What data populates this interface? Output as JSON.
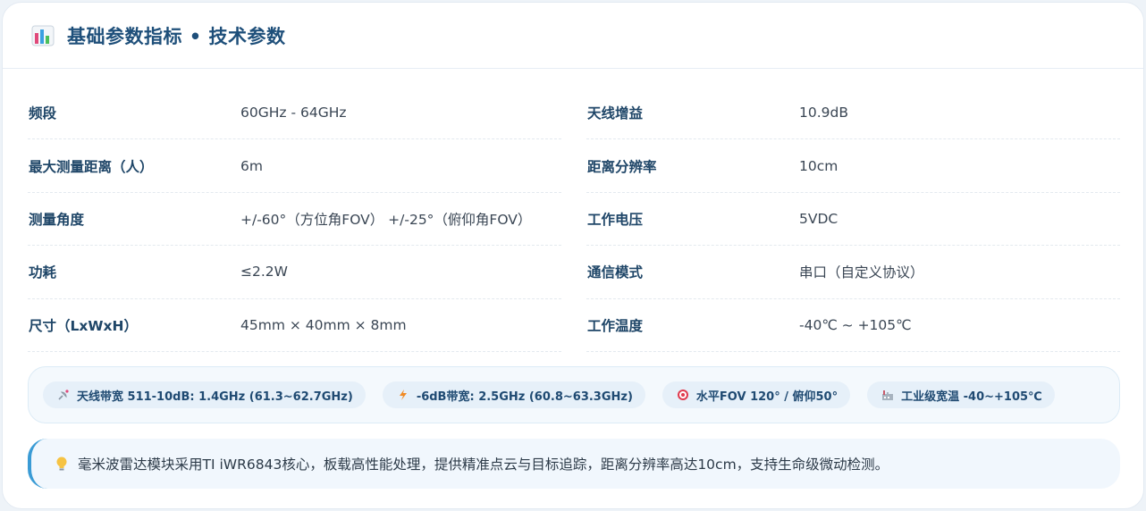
{
  "header": {
    "title": "基础参数指标 • 技术参数",
    "icon": "bar-chart-icon"
  },
  "params": [
    {
      "label": "频段",
      "value": "60GHz - 64GHz"
    },
    {
      "label": "天线增益",
      "value": "10.9dB"
    },
    {
      "label": "最大测量距离（人）",
      "value": "6m"
    },
    {
      "label": "距离分辨率",
      "value": "10cm"
    },
    {
      "label": "测量角度",
      "value": "+/-60°（方位角FOV） +/-25°（俯仰角FOV）"
    },
    {
      "label": "工作电压",
      "value": "5VDC"
    },
    {
      "label": "功耗",
      "value": "≤2.2W"
    },
    {
      "label": "通信模式",
      "value": "串口（自定义协议）"
    },
    {
      "label": "尺寸（LxWxH）",
      "value": "45mm × 40mm × 8mm"
    },
    {
      "label": "工作温度",
      "value": "-40℃ ~ +105℃"
    }
  ],
  "badges": [
    {
      "text": "天线带宽 511-10dB: 1.4GHz (61.3~62.7GHz)",
      "icon": "satellite-icon"
    },
    {
      "text": "-6dB带宽: 2.5GHz (60.8~63.3GHz)",
      "icon": "lightning-icon"
    },
    {
      "text": "水平FOV 120° / 俯仰50°",
      "icon": "target-icon"
    },
    {
      "text": "工业级宽温 -40~+105℃",
      "icon": "factory-icon"
    }
  ],
  "note": {
    "icon": "lightbulb-icon",
    "text": "毫米波雷达模块采用TI iWR6843核心，板载高性能处理，提供精准点云与目标追踪，距离分辨率高达10cm，支持生命级微动检测。"
  },
  "colors": {
    "title": "#1e4f7a",
    "label": "#1f4668",
    "accent": "#3a9bd5",
    "badge_bg": "#e6f0f9"
  }
}
